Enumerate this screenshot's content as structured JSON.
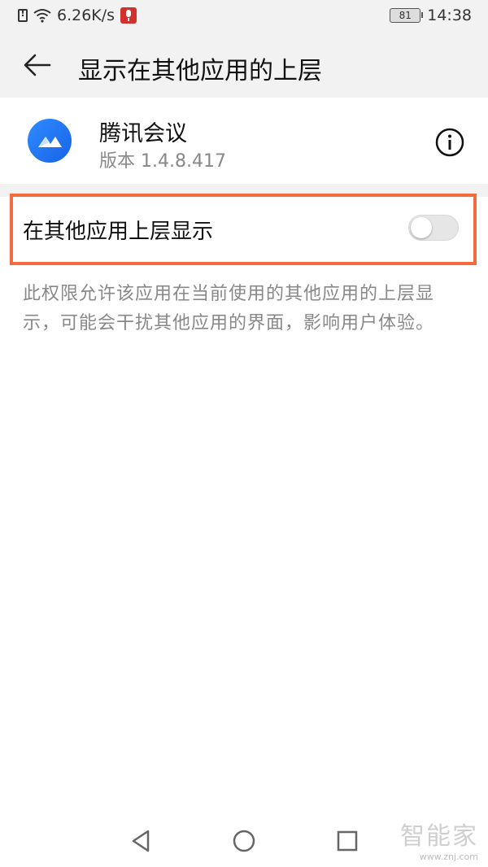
{
  "status_bar": {
    "speed": "6.26K/s",
    "battery": "81",
    "time": "14:38",
    "icons": [
      "alert-icon",
      "wifi-icon",
      "mic-icon",
      "battery-icon"
    ]
  },
  "app_bar": {
    "title": "显示在其他应用的上层",
    "back_icon": "arrow-left-icon"
  },
  "app_info": {
    "name": "腾讯会议",
    "version": "版本 1.4.8.417",
    "info_icon": "info-circle-icon",
    "logo_color": "#1E6FF1"
  },
  "permission": {
    "label": "在其他应用上层显示",
    "enabled": false,
    "description": "此权限允许该应用在当前使用的其他应用的上层显示，可能会干扰其他应用的界面，影响用户体验。"
  },
  "nav_bar": {
    "icons": [
      "back-triangle-icon",
      "home-circle-icon",
      "recents-square-icon"
    ]
  },
  "watermark": {
    "logo": "智能家",
    "url": "www.znj.com"
  },
  "colors": {
    "highlight": "#F36C3D",
    "background": "#F2F2F2"
  }
}
